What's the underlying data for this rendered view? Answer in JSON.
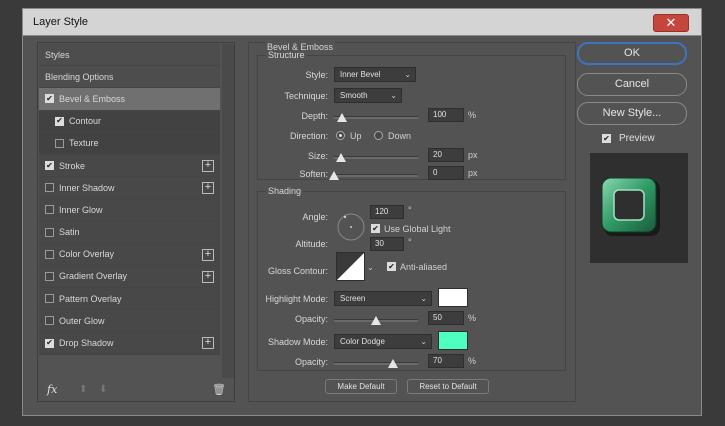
{
  "window": {
    "title": "Layer Style",
    "close_glyph": "✕"
  },
  "styles_list": {
    "items": [
      {
        "label": "Styles",
        "checkbox": null,
        "plus": false,
        "state": "header"
      },
      {
        "label": "Blending Options",
        "checkbox": null,
        "plus": false,
        "state": "header"
      },
      {
        "label": "Bevel & Emboss",
        "checkbox": true,
        "plus": false,
        "state": "selected"
      },
      {
        "label": "Contour",
        "checkbox": true,
        "plus": false,
        "state": "sub"
      },
      {
        "label": "Texture",
        "checkbox": false,
        "plus": false,
        "state": "sub"
      },
      {
        "label": "Stroke",
        "checkbox": true,
        "plus": true,
        "state": "normal"
      },
      {
        "label": "Inner Shadow",
        "checkbox": false,
        "plus": true,
        "state": "normal"
      },
      {
        "label": "Inner Glow",
        "checkbox": false,
        "plus": false,
        "state": "normal"
      },
      {
        "label": "Satin",
        "checkbox": false,
        "plus": false,
        "state": "normal"
      },
      {
        "label": "Color Overlay",
        "checkbox": false,
        "plus": true,
        "state": "normal"
      },
      {
        "label": "Gradient Overlay",
        "checkbox": false,
        "plus": true,
        "state": "normal"
      },
      {
        "label": "Pattern Overlay",
        "checkbox": false,
        "plus": false,
        "state": "normal"
      },
      {
        "label": "Outer Glow",
        "checkbox": false,
        "plus": false,
        "state": "normal"
      },
      {
        "label": "Drop Shadow",
        "checkbox": true,
        "plus": true,
        "state": "normal"
      }
    ],
    "footer": {
      "fx_label": "fx",
      "up_glyph": "⬆",
      "down_glyph": "⬇",
      "trash_glyph": "🗑"
    }
  },
  "bevel": {
    "section_title": "Bevel & Emboss",
    "structure": {
      "title": "Structure",
      "style_label": "Style:",
      "style_value": "Inner Bevel",
      "technique_label": "Technique:",
      "technique_value": "Smooth",
      "depth_label": "Depth:",
      "depth_value": "100",
      "depth_unit": "%",
      "depth_fraction": 0.1,
      "direction_label": "Direction:",
      "direction_up": "Up",
      "direction_down": "Down",
      "direction_selected": "Up",
      "size_label": "Size:",
      "size_value": "20",
      "size_unit": "px",
      "size_fraction": 0.08,
      "soften_label": "Soften:",
      "soften_value": "0",
      "soften_unit": "px",
      "soften_fraction": 0.0
    },
    "shading": {
      "title": "Shading",
      "angle_label": "Angle:",
      "angle_value": "120",
      "angle_unit": "°",
      "global_light_label": "Use Global Light",
      "global_light": true,
      "altitude_label": "Altitude:",
      "altitude_value": "30",
      "altitude_unit": "°",
      "gloss_label": "Gloss Contour:",
      "anti_alias_label": "Anti-aliased",
      "anti_alias": true,
      "highlight_mode_label": "Highlight Mode:",
      "highlight_mode": "Screen",
      "highlight_color": "#ffffff",
      "highlight_opacity_label": "Opacity:",
      "highlight_opacity": "50",
      "highlight_opacity_unit": "%",
      "highlight_opacity_fraction": 0.5,
      "shadow_mode_label": "Shadow Mode:",
      "shadow_mode": "Color Dodge",
      "shadow_color": "#4fffc0",
      "shadow_opacity_label": "Opacity:",
      "shadow_opacity": "70",
      "shadow_opacity_unit": "%",
      "shadow_opacity_fraction": 0.7
    },
    "make_default": "Make Default",
    "reset_default": "Reset to Default"
  },
  "actions": {
    "ok": "OK",
    "cancel": "Cancel",
    "new_style": "New Style...",
    "preview_label": "Preview",
    "preview_checked": true
  },
  "colors": {
    "accent_blue": "#3f73c2",
    "preview_green": "#2e9a64"
  }
}
